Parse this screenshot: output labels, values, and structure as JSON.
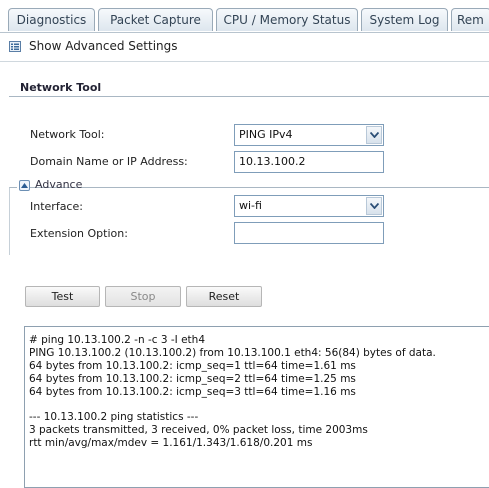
{
  "tabs": [
    {
      "label": "Diagnostics"
    },
    {
      "label": "Packet Capture"
    },
    {
      "label": "CPU / Memory Status"
    },
    {
      "label": "System Log"
    },
    {
      "label": "Rem"
    }
  ],
  "toolbar": {
    "advanced_label": "Show Advanced Settings"
  },
  "section": {
    "title": "Network Tool"
  },
  "form": {
    "network_tool_label": "Network Tool:",
    "network_tool_value": "PING IPv4",
    "domain_label": "Domain Name or IP Address:",
    "domain_value": "10.13.100.2",
    "advance_legend": "Advance",
    "interface_label": "Interface:",
    "interface_value": "wi-fi",
    "extension_label": "Extension Option:",
    "extension_value": ""
  },
  "buttons": {
    "test": "Test",
    "stop": "Stop",
    "reset": "Reset"
  },
  "output": {
    "lines": [
      "# ping 10.13.100.2 -n -c 3 -I eth4",
      "PING 10.13.100.2 (10.13.100.2) from 10.13.100.1 eth4: 56(84) bytes of data.",
      "64 bytes from 10.13.100.2: icmp_seq=1 ttl=64 time=1.61 ms",
      "64 bytes from 10.13.100.2: icmp_seq=2 ttl=64 time=1.25 ms",
      "64 bytes from 10.13.100.2: icmp_seq=3 ttl=64 time=1.16 ms",
      "",
      "--- 10.13.100.2 ping statistics ---",
      "3 packets transmitted, 3 received, 0% packet loss, time 2003ms",
      "rtt min/avg/max/mdev = 1.161/1.343/1.618/0.201 ms"
    ]
  }
}
